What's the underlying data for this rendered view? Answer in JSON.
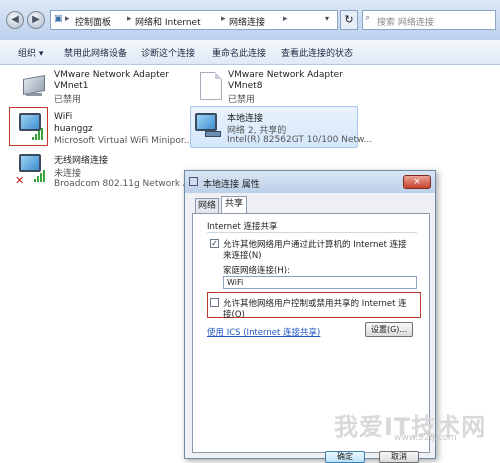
{
  "address_bar": {
    "crumbs": [
      "控制面板",
      "网络和 Internet",
      "网络连接"
    ],
    "search_placeholder": "搜索 网络连接"
  },
  "toolbar": {
    "items": [
      "组织 ▾",
      "禁用此网络设备",
      "诊断这个连接",
      "重命名此连接",
      "查看此连接的状态"
    ]
  },
  "adapters": [
    {
      "name": "VMware Network Adapter",
      "line2": "VMnet1",
      "status": "已禁用"
    },
    {
      "name": "VMware Network Adapter",
      "line2": "VMnet8",
      "status": "已禁用"
    },
    {
      "name": "WiFi",
      "line2": "huanggz",
      "device": "Microsoft Virtual WiFi Minipor..."
    },
    {
      "name": "本地连接",
      "line2": "网络 2, 共享的",
      "device": "Intel(R) 82562GT 10/100 Netw..."
    },
    {
      "name": "无线网络连接",
      "line2": "未连接",
      "device": "Broadcom 802.11g Network A..."
    }
  ],
  "dialog": {
    "title": "本地连接 属性",
    "close": "×",
    "tabs": [
      "网络",
      "共享"
    ],
    "group_title": "Internet 连接共享",
    "allow_share_line1": "允许其他网络用户通过此计算机的 Internet 连接",
    "allow_share_line2": "来连接(N)",
    "allow_share_checked": true,
    "home_conn_label": "家庭网络连接(H):",
    "home_conn_value": "WiFi",
    "allow_control_line1": "允许其他网络用户控制或禁用共享的 Internet 连",
    "allow_control_line2": "接(O)",
    "allow_control_checked": false,
    "ics_link": "使用 ICS (Internet 连接共享)",
    "settings_button": "设置(G)...",
    "ok_button": "确定",
    "cancel_button": "取消"
  },
  "watermark": {
    "brand": "我爱IT技术网",
    "url": "www.52ij.com"
  }
}
